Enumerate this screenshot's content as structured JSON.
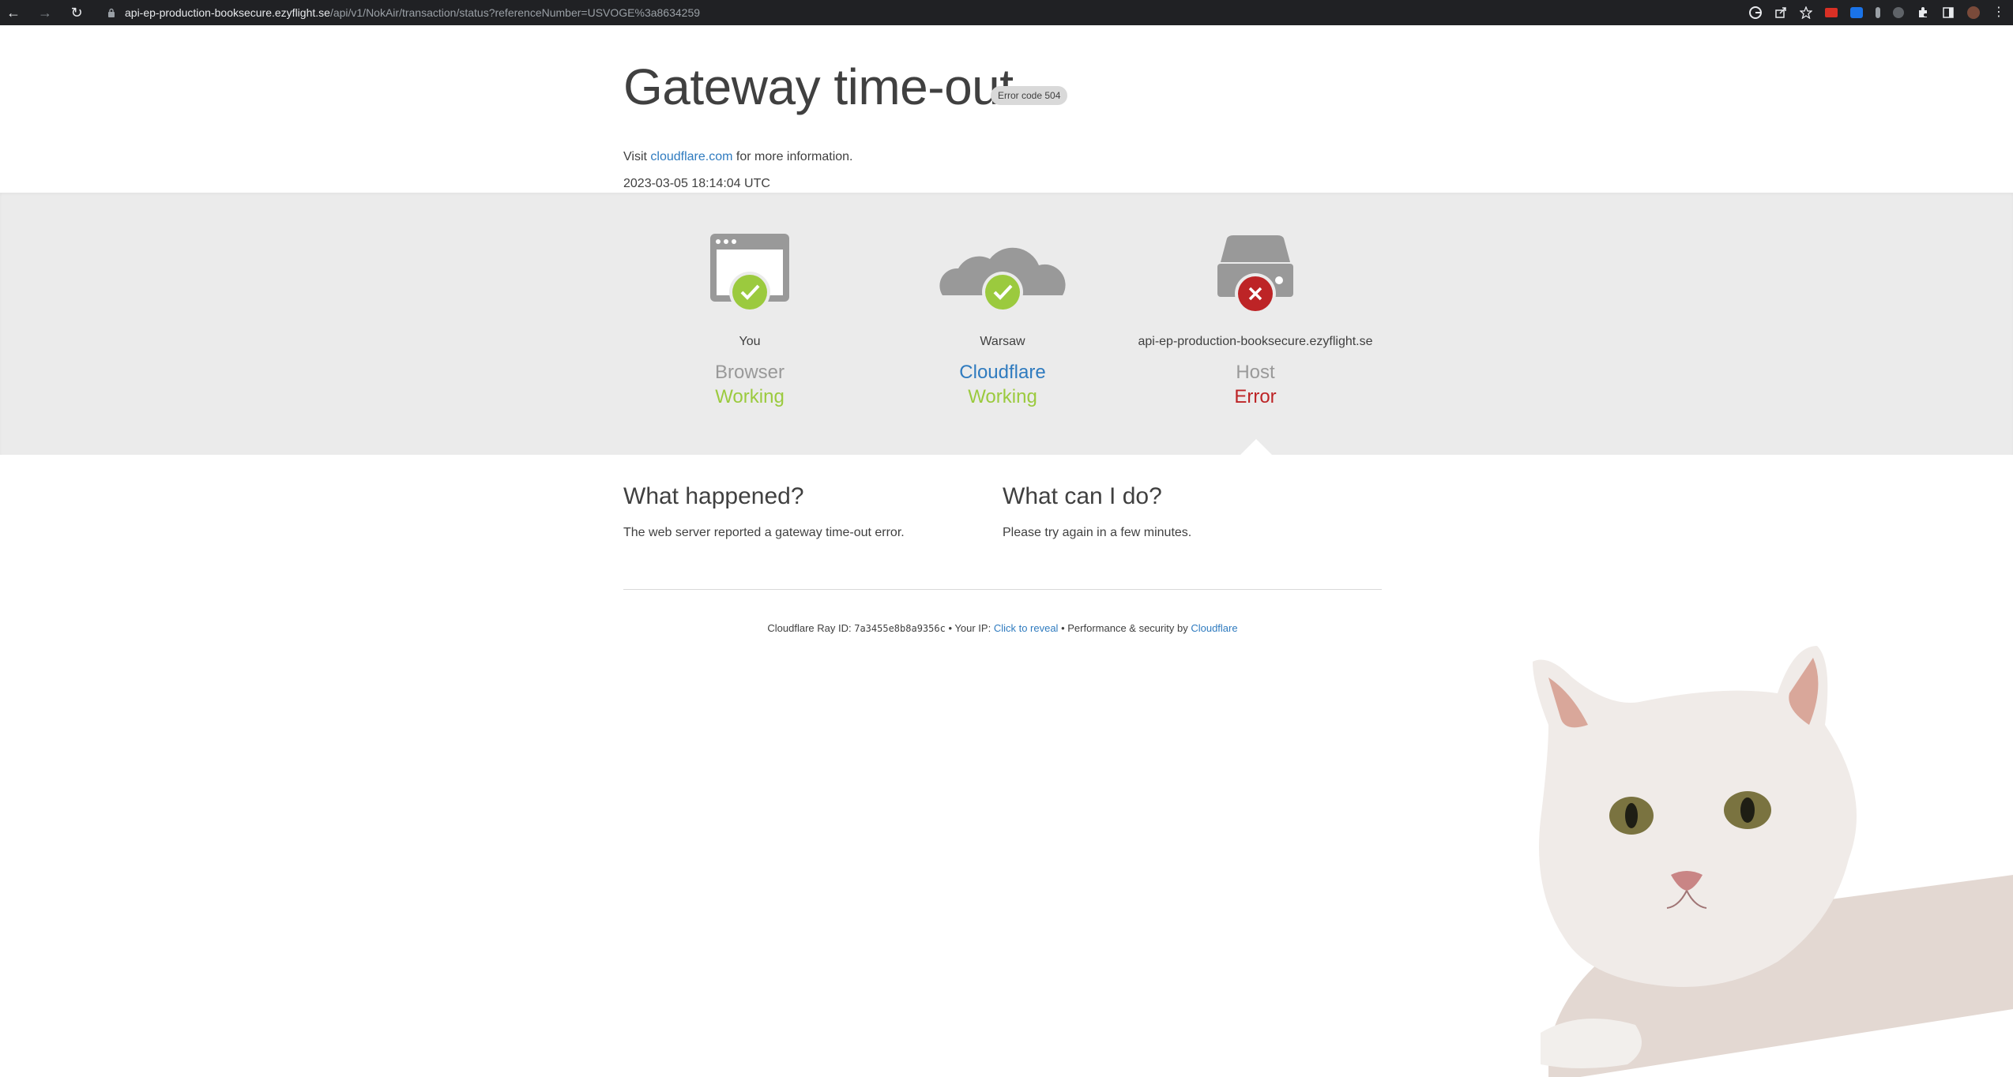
{
  "browser": {
    "url_host": "api-ep-production-booksecure.ezyflight.se",
    "url_path": "/api/v1/NokAir/transaction/status?referenceNumber=USVOGE%3a8634259"
  },
  "header": {
    "title": "Gateway time-out",
    "badge": "Error code 504",
    "visit_prefix": "Visit",
    "visit_link": "cloudflare.com",
    "visit_suffix": "for more information.",
    "timestamp": "2023-03-05 18:14:04 UTC"
  },
  "status": [
    {
      "place": "You",
      "role": "Browser",
      "state": "Working",
      "icon": "browser-window-icon",
      "ok": true
    },
    {
      "place": "Warsaw",
      "role": "Cloudflare",
      "state": "Working",
      "icon": "cloud-icon",
      "ok": true
    },
    {
      "place": "api-ep-production-booksecure.ezyflight.se",
      "role": "Host",
      "state": "Error",
      "icon": "server-icon",
      "ok": false
    }
  ],
  "info": {
    "happened_title": "What happened?",
    "happened_text": "The web server reported a gateway time-out error.",
    "cando_title": "What can I do?",
    "cando_text": "Please try again in a few minutes."
  },
  "footer": {
    "ray_label": "Cloudflare Ray ID:",
    "ray_id": "7a3455e8b8a9356c",
    "sep1": "•",
    "ip_label": "Your IP:",
    "ip_link": "Click to reveal",
    "sep2": "•",
    "perf_label": "Performance & security by",
    "perf_link": "Cloudflare"
  },
  "colors": {
    "working": "#9bca3e",
    "error": "#bd2426",
    "link": "#2f7bbf",
    "gray_band": "#ebebeb",
    "icon_gray": "#999999"
  }
}
